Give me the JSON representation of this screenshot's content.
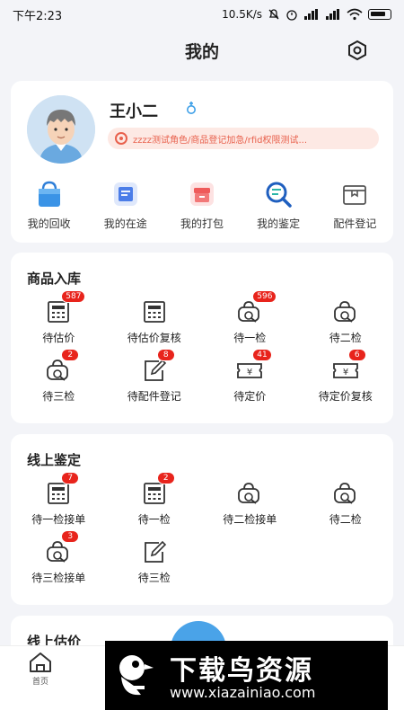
{
  "status_bar": {
    "time": "下午2:23",
    "speed": "10.5K/s"
  },
  "header": {
    "title": "我的",
    "settings_icon": "settings-hexagon-icon"
  },
  "profile": {
    "name": "王小二",
    "gender_icon": "male-icon",
    "role": "zzzz测试角色/商品登记加急/rfid权限测试...",
    "quick_actions": [
      {
        "label": "我的回收",
        "icon": "shopping-bag-icon"
      },
      {
        "label": "我的在途",
        "icon": "document-icon"
      },
      {
        "label": "我的打包",
        "icon": "package-box-icon"
      },
      {
        "label": "我的鉴定",
        "icon": "magnifier-icon"
      },
      {
        "label": "配件登记",
        "icon": "box-outline-icon"
      }
    ]
  },
  "storage": {
    "title": "商品入库",
    "items": [
      {
        "label": "待估价",
        "badge": "587",
        "icon": "calculator-icon"
      },
      {
        "label": "待估价复核",
        "badge": "",
        "icon": "calculator-icon"
      },
      {
        "label": "待一检",
        "badge": "596",
        "icon": "bag-search-icon"
      },
      {
        "label": "待二检",
        "badge": "",
        "icon": "bag-search-icon"
      },
      {
        "label": "待三检",
        "badge": "2",
        "icon": "bag-search-icon"
      },
      {
        "label": "待配件登记",
        "badge": "8",
        "icon": "edit-icon"
      },
      {
        "label": "待定价",
        "badge": "41",
        "icon": "price-ticket-icon"
      },
      {
        "label": "待定价复核",
        "badge": "6",
        "icon": "price-ticket-icon"
      }
    ]
  },
  "online": {
    "title": "线上鉴定",
    "items": [
      {
        "label": "待一检接单",
        "badge": "7",
        "icon": "calculator-icon"
      },
      {
        "label": "待一检",
        "badge": "2",
        "icon": "calculator-icon"
      },
      {
        "label": "待二检接单",
        "badge": "",
        "icon": "bag-search-icon"
      },
      {
        "label": "待二检",
        "badge": "",
        "icon": "bag-search-icon"
      },
      {
        "label": "待三检接单",
        "badge": "3",
        "icon": "bag-search-icon"
      },
      {
        "label": "待三检",
        "badge": "",
        "icon": "edit-icon"
      }
    ]
  },
  "estimate": {
    "title": "线上估价"
  },
  "bottom_nav": {
    "home_label": "首页"
  },
  "watermark": {
    "title": "下载鸟资源",
    "url": "www.xiazainiao.com"
  },
  "colors": {
    "accent": "#e8241c",
    "brand_blue": "#2f7fd8",
    "card_bg": "#ffffff",
    "page_bg": "#f3f4f8"
  }
}
